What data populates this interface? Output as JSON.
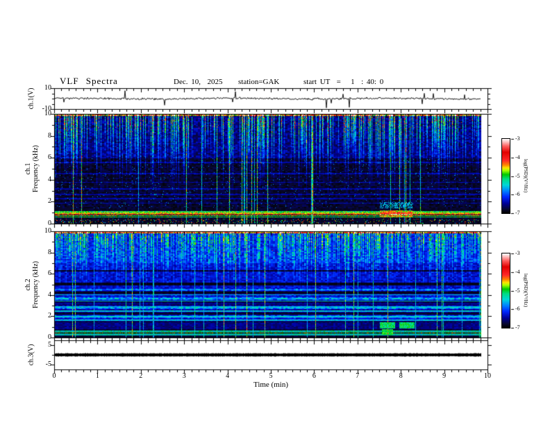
{
  "header": {
    "title": "VLF Spectra",
    "date": "Dec. 10,  2025",
    "station": "station=GAK",
    "start_ut": "start UT  =   1  : 40: 0"
  },
  "xaxis": {
    "label": "Time  (min)",
    "ticks": [
      "0",
      "1",
      "2",
      "3",
      "4",
      "5",
      "6",
      "7",
      "8",
      "9",
      "10"
    ],
    "minor_per_major": 6
  },
  "colorbar": {
    "label": "log(PSD)(V²/Hz)",
    "ticks": [
      "-3",
      "-4",
      "-5",
      "-6",
      "-7"
    ],
    "range": [
      -3,
      -7
    ],
    "colormap": [
      [
        0.0,
        [
          0,
          0,
          0
        ]
      ],
      [
        0.05,
        [
          8,
          8,
          45
        ]
      ],
      [
        0.13,
        [
          0,
          0,
          150
        ]
      ],
      [
        0.22,
        [
          0,
          40,
          255
        ]
      ],
      [
        0.3,
        [
          0,
          130,
          255
        ]
      ],
      [
        0.38,
        [
          0,
          215,
          215
        ]
      ],
      [
        0.46,
        [
          0,
          220,
          130
        ]
      ],
      [
        0.52,
        [
          0,
          200,
          0
        ]
      ],
      [
        0.575,
        [
          170,
          255,
          0
        ]
      ],
      [
        0.61,
        [
          255,
          225,
          0
        ]
      ],
      [
        0.65,
        [
          255,
          130,
          0
        ]
      ],
      [
        0.71,
        [
          255,
          40,
          40
        ]
      ],
      [
        0.82,
        [
          225,
          0,
          0
        ]
      ],
      [
        0.9,
        [
          255,
          90,
          90
        ]
      ],
      [
        0.96,
        [
          255,
          195,
          195
        ]
      ],
      [
        1.0,
        [
          255,
          255,
          255
        ]
      ]
    ]
  },
  "panels": {
    "ch1_wave": {
      "ylabel": "ch.1(V)",
      "yticks": [
        "10",
        "-10"
      ]
    },
    "ch1_spec": {
      "label_line1": "ch.1",
      "label_line2": "Frequency  (kHz)",
      "yticks": [
        "10",
        "8",
        "6",
        "4",
        "2",
        "0"
      ]
    },
    "ch2_spec": {
      "label_line1": "ch.2",
      "label_line2": "Frequency  (kHz)",
      "yticks": [
        "10",
        "8",
        "6",
        "4",
        "2",
        "0"
      ]
    },
    "ch3_wave": {
      "ylabel": "ch.3(V)",
      "yticks": [
        "5",
        "-5"
      ]
    }
  },
  "chart_data": [
    {
      "type": "line",
      "name": "ch1-voltage",
      "ylabel": "ch.1(V)",
      "ylim": [
        -12.5,
        12.5
      ],
      "yticks": [
        10,
        -10
      ],
      "x_range_min": [
        0,
        9.85
      ],
      "description": "Black broadband noise trace centered at 0 V, about ±1.5 V, with frequent impulsive spikes (mostly downward) reaching about ±8 V",
      "gen": {
        "seed": 3,
        "noise_v": 0.9,
        "slow_wiggle_v": 0.35,
        "spike_prob": 0.013,
        "spike_v_min": 3,
        "spike_v_max": 8.5,
        "spike_down_frac": 0.55
      }
    },
    {
      "type": "heatmap",
      "name": "ch1-spectrogram",
      "ylabel": "ch.1 Frequency (kHz)",
      "ylim": [
        0,
        10
      ],
      "x_range_min": [
        0,
        9.85
      ],
      "zlabel": "log(PSD)(V²/Hz)",
      "zlim": [
        -7,
        -3
      ],
      "features": [
        "dense green/cyan impulsive vertical streaks, strongest above 6 kHz, fading downward",
        "near-black background 1.5-6 kHz with faint dark-blue horizontal lines",
        "occasional thin cyan vertical lines spanning the full band",
        "bright yellow/green harmonic band 0.6-1.2 kHz with a red core line near 0.9 kHz",
        "orange/red enhancement of the low band near 7.5-8.25 min",
        "scattered colored speckles below 0.5 kHz and a bright speckled line at the 10 kHz top edge"
      ],
      "gen": {
        "seed": 11,
        "streak_density": 0.32,
        "streak_depth_min": 4.0,
        "streak_depth_range": 4.5,
        "full_line_density": 0.035,
        "faint_lines": [
          5.6,
          4.6,
          3.8,
          3.2,
          2.7,
          2.3,
          1.9
        ],
        "band_lines": [
          [
            1.12,
            0.05,
            0.5
          ],
          [
            0.98,
            0.045,
            0.6
          ],
          [
            0.88,
            0.04,
            0.74
          ],
          [
            0.76,
            0.045,
            0.55
          ],
          [
            0.62,
            0.04,
            0.48
          ]
        ],
        "blob": [
          7.5,
          8.25,
          1.25
        ],
        "low_speckle": 0.1
      }
    },
    {
      "type": "heatmap",
      "name": "ch2-spectrogram",
      "ylabel": "ch.2 Frequency (kHz)",
      "ylim": [
        0,
        10
      ],
      "x_range_min": [
        0,
        9.85
      ],
      "zlabel": "log(PSD)(V²/Hz)",
      "zlim": [
        -7,
        -3
      ],
      "features": [
        "dense green vertical streaks on a blue background above 7 kHz",
        "blue background 4.6-7 kHz with dark horizontal bands near 5 and 6.3 kHz",
        "alternating cyan/blue horizontal banding 1.5-4.6 kHz",
        "cyan/green horizontal lines below 0.8 kHz",
        "green/cyan blocks near 0.9-1.4 kHz around 7.5-8.3 min",
        "thin cyan vertical lines spanning the full band, bright speckled line at top edge"
      ],
      "gen": {
        "seed": 23,
        "streak_density": 0.5,
        "streak_depth_min": 3.0,
        "streak_depth_range": 3.0,
        "full_line_density": 0.045,
        "dark_bands": [
          [
            5.05,
            0.13
          ],
          [
            6.3,
            0.07
          ]
        ],
        "cyan_lines": [
          4.05,
          3.45,
          2.95,
          2.5,
          2.0,
          1.65
        ],
        "low_lines": [
          [
            0.62,
            0.04,
            0.42
          ],
          [
            0.47,
            0.05,
            0.5
          ],
          [
            0.3,
            0.04,
            0.4
          ]
        ],
        "blob": [
          7.5,
          8.3
        ]
      }
    },
    {
      "type": "line",
      "name": "ch3-voltage",
      "ylabel": "ch.3(V)",
      "ylim": [
        -7.5,
        7.5
      ],
      "yticks": [
        5,
        -5
      ],
      "x_range_min": [
        0,
        9.85
      ],
      "value_v": 0,
      "description": "Flat thick black trace at 0 V for the whole record (channel inactive)"
    }
  ]
}
